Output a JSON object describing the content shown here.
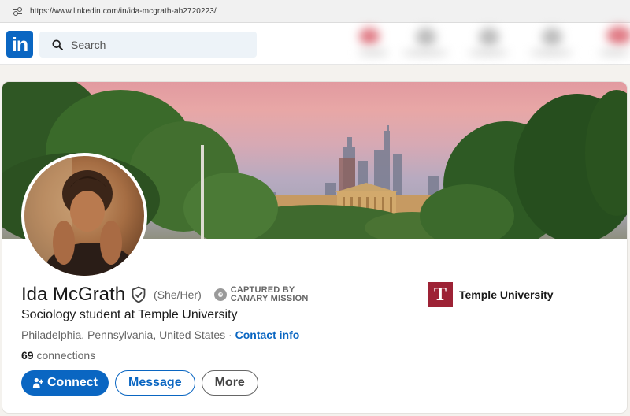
{
  "browser": {
    "url": "https://www.linkedin.com/in/ida-mcgrath-ab2720223/"
  },
  "nav": {
    "logo_text": "in",
    "search_placeholder": "Search"
  },
  "profile": {
    "name": "Ida McGrath",
    "pronouns": "(She/Her)",
    "badge_line1": "CAPTURED BY",
    "badge_line2": "CANARY MISSION",
    "headline": "Sociology student at Temple University",
    "location": "Philadelphia, Pennsylvania, United States",
    "location_separator": " · ",
    "contact_info_label": "Contact info",
    "connections_count": "69",
    "connections_label": " connections",
    "education": {
      "logo_letter": "T",
      "name": "Temple University"
    }
  },
  "actions": {
    "connect_label": "Connect",
    "message_label": "Message",
    "more_label": "More"
  },
  "colors": {
    "linkedin_blue": "#0a66c2",
    "temple_cherry": "#9d2235"
  }
}
